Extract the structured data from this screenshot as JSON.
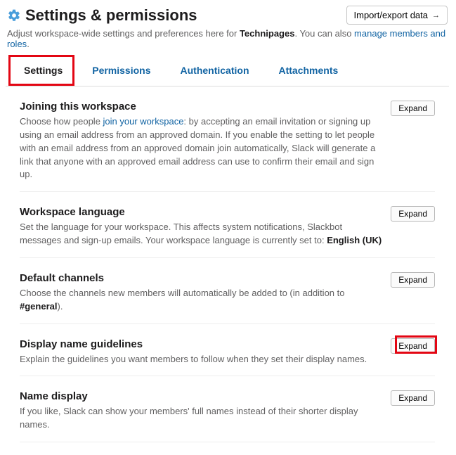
{
  "header": {
    "title": "Settings & permissions",
    "import_label": "Import/export data",
    "sub_prefix": "Adjust workspace-wide settings and preferences here for ",
    "workspace_name": "Technipages",
    "sub_middle": ". You can also ",
    "manage_link": "manage members and roles",
    "sub_end": "."
  },
  "tabs": {
    "items": [
      "Settings",
      "Permissions",
      "Authentication",
      "Attachments"
    ],
    "active_index": 0,
    "highlight_index": 0
  },
  "sections": [
    {
      "title": "Joining this workspace",
      "expand_label": "Expand",
      "desc_parts": [
        {
          "t": "Choose how people "
        },
        {
          "t": "join your workspace",
          "cls": "link"
        },
        {
          "t": ": by accepting an email invitation or signing up using an email address from an approved domain. If you enable the setting to let people with an email address from an approved domain join automatically, Slack will generate a link that anyone with an approved email address can use to confirm their email and sign up."
        }
      ]
    },
    {
      "title": "Workspace language",
      "expand_label": "Expand",
      "desc_parts": [
        {
          "t": "Set the language for your workspace. This affects system notifications, Slackbot messages and sign-up emails. Your workspace language is currently set to: "
        },
        {
          "t": "English (UK)",
          "cls": "bold"
        }
      ]
    },
    {
      "title": "Default channels",
      "expand_label": "Expand",
      "desc_parts": [
        {
          "t": "Choose the channels new members will automatically be added to (in addition to "
        },
        {
          "t": "#general",
          "cls": "bold"
        },
        {
          "t": ")."
        }
      ]
    },
    {
      "title": "Display name guidelines",
      "expand_label": "Expand",
      "highlight_expand": true,
      "desc_parts": [
        {
          "t": "Explain the guidelines you want members to follow when they set their display names."
        }
      ]
    },
    {
      "title": "Name display",
      "expand_label": "Expand",
      "desc_parts": [
        {
          "t": "If you like, Slack can show your members' full names instead of their shorter display names."
        }
      ]
    }
  ]
}
